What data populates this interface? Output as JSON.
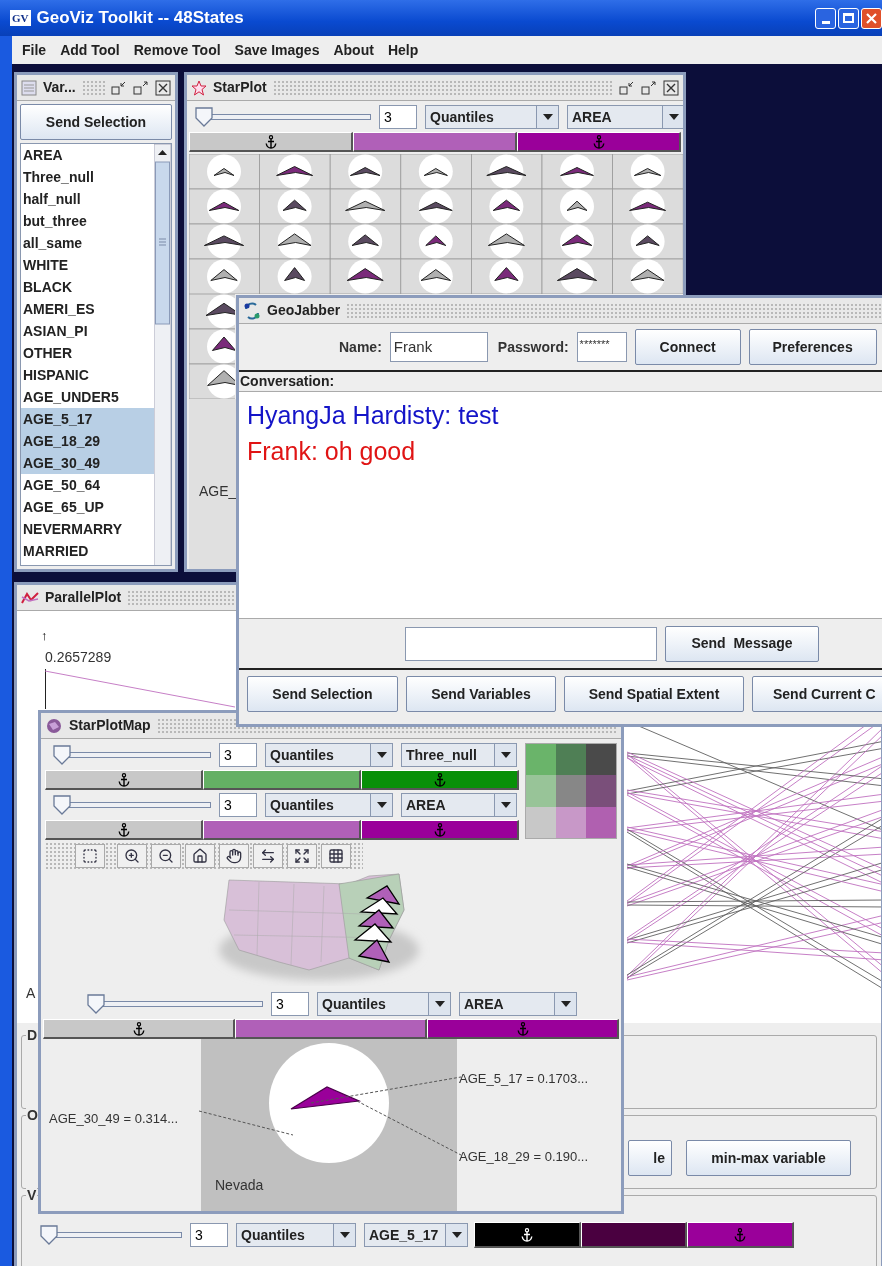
{
  "window": {
    "logo": "GV",
    "title": "GeoViz Toolkit -- 48States"
  },
  "menu": [
    {
      "label": "File"
    },
    {
      "label": "Add Tool"
    },
    {
      "label": "Remove Tool"
    },
    {
      "label": "Save Images"
    },
    {
      "label": "About"
    },
    {
      "label": "Help"
    }
  ],
  "variables_frame": {
    "title": "Var...",
    "button": "Send Selection",
    "items": [
      {
        "label": "AREA",
        "selected": false
      },
      {
        "label": "Three_null",
        "selected": false
      },
      {
        "label": "half_null",
        "selected": false
      },
      {
        "label": "but_three",
        "selected": false
      },
      {
        "label": "all_same",
        "selected": false
      },
      {
        "label": "WHITE",
        "selected": false
      },
      {
        "label": "BLACK",
        "selected": false
      },
      {
        "label": "AMERI_ES",
        "selected": false
      },
      {
        "label": "ASIAN_PI",
        "selected": false
      },
      {
        "label": "OTHER",
        "selected": false
      },
      {
        "label": "HISPANIC",
        "selected": false
      },
      {
        "label": "AGE_UNDER5",
        "selected": false
      },
      {
        "label": "AGE_5_17",
        "selected": true
      },
      {
        "label": "AGE_18_29",
        "selected": true
      },
      {
        "label": "AGE_30_49",
        "selected": true
      },
      {
        "label": "AGE_50_64",
        "selected": false
      },
      {
        "label": "AGE_65_UP",
        "selected": false
      },
      {
        "label": "NEVERMARRY",
        "selected": false
      },
      {
        "label": "MARRIED",
        "selected": false
      }
    ]
  },
  "starplot": {
    "title": "StarPlot",
    "controls": {
      "slider": {
        "level": 0
      },
      "classes": "3",
      "classification": "Quantiles",
      "variable": "AREA",
      "class_bar": [
        {
          "color": "#c8c8c8",
          "anchor": true
        },
        {
          "color": "#b060b8",
          "anchor": false
        },
        {
          "color": "#9a009a",
          "anchor": true
        }
      ]
    },
    "axis_label": "AGE_"
  },
  "parallel_plot": {
    "title": "ParallelPlot",
    "axis_arrow": "↑",
    "axis_max": "0.2657289",
    "axis_label": "A",
    "groups": [
      {
        "label": "D"
      },
      {
        "label": "O",
        "buttons": [
          "le",
          "min-max variable"
        ]
      },
      {
        "label": "V"
      }
    ],
    "controls": {
      "slider": {
        "level": 0
      },
      "classes": "3",
      "classification": "Quantiles",
      "variable": "AGE_5_17",
      "class_bar": [
        {
          "color": "#000000",
          "anchor": true
        },
        {
          "color": "#4a0040",
          "anchor": false
        },
        {
          "color": "#9a009a",
          "anchor": true
        }
      ]
    }
  },
  "geojabber": {
    "title": "GeoJabber",
    "name_label": "Name:",
    "name_value": "Frank",
    "password_label": "Password:",
    "password_value": "*******",
    "buttons": [
      "Connect",
      "Preferences"
    ],
    "conversation_label": "Conversation:",
    "messages": [
      {
        "text": "HyangJa Hardisty: test",
        "color": "#1414c8"
      },
      {
        "text": "Frank: oh good",
        "color": "#e01414"
      }
    ],
    "send_button": "Send  Message",
    "bottom_buttons": [
      "Send Selection",
      "Send Variables",
      "Send Spatial Extent",
      "Send Current C"
    ]
  },
  "starplot_map": {
    "title": "StarPlotMap",
    "rows": [
      {
        "slider": {
          "level": 0
        },
        "classes": "3",
        "classification": "Quantiles",
        "variable": "Three_null",
        "class_bar": [
          {
            "color": "#c8c8c8",
            "anchor": true
          },
          {
            "color": "#64b064",
            "anchor": false
          },
          {
            "color": "#089008",
            "anchor": true
          }
        ]
      },
      {
        "slider": {
          "level": 0
        },
        "classes": "3",
        "classification": "Quantiles",
        "variable": "AREA",
        "class_bar": [
          {
            "color": "#c8c8c8",
            "anchor": true
          },
          {
            "color": "#b060b8",
            "anchor": false
          },
          {
            "color": "#9a009a",
            "anchor": true
          }
        ]
      }
    ],
    "legend": [
      {
        "color": "#6ab46a"
      },
      {
        "color": "#4f7f55"
      },
      {
        "color": "#4a4a4a"
      },
      {
        "color": "#98c498"
      },
      {
        "color": "#878787"
      },
      {
        "color": "#7a4f7a"
      },
      {
        "color": "#c8c8c8"
      },
      {
        "color": "#c898c8"
      },
      {
        "color": "#b060b0"
      }
    ],
    "glyph_controls": {
      "slider": {
        "level": 0
      },
      "classes": "3",
      "classification": "Quantiles",
      "variable": "AREA",
      "class_bar": [
        {
          "color": "#c8c8c8",
          "anchor": true
        },
        {
          "color": "#b060b8",
          "anchor": false
        },
        {
          "color": "#9a009a",
          "anchor": true
        }
      ]
    },
    "detail": {
      "labels": [
        "AGE_5_17 = 0.1703...",
        "AGE_30_49 = 0.314...",
        "AGE_18_29 = 0.190..."
      ],
      "state": "Nevada"
    }
  }
}
